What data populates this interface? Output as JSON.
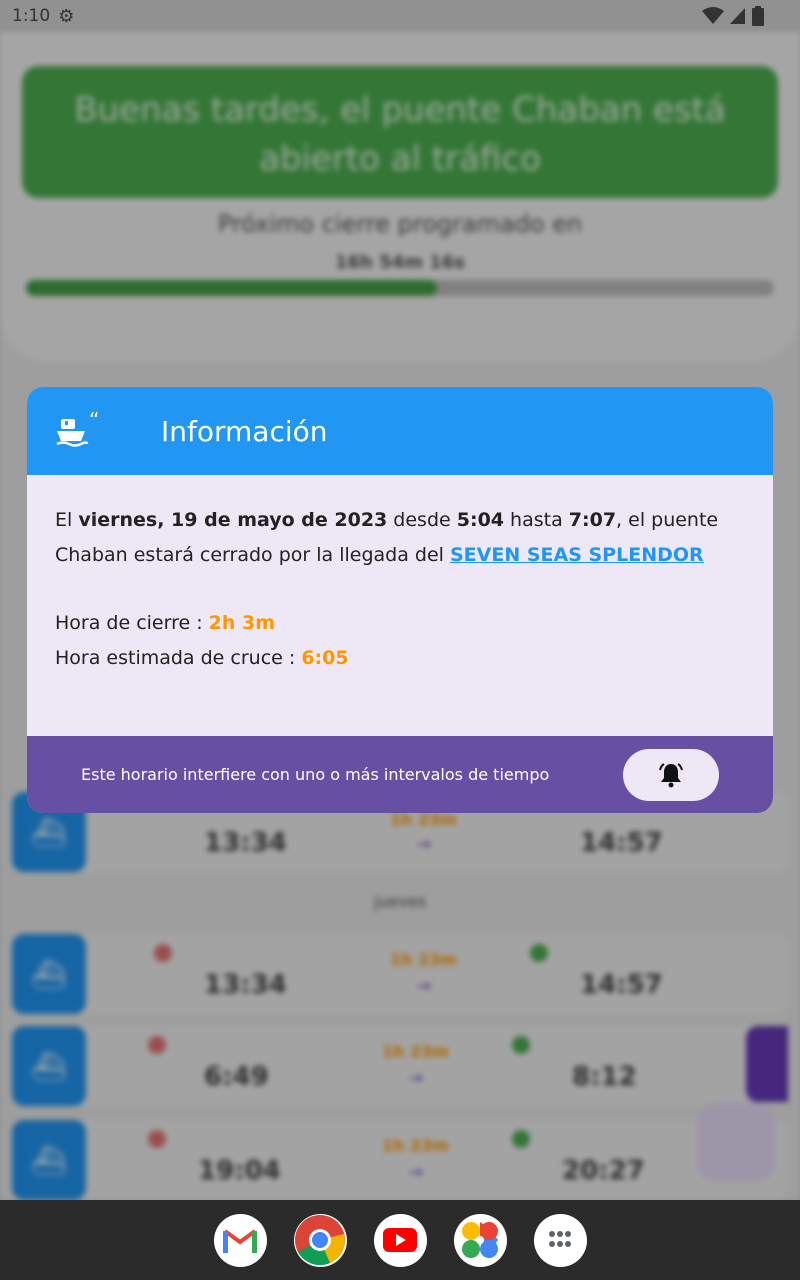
{
  "status_bar": {
    "time": "1:10"
  },
  "background": {
    "banner_text": "Buenas tardes, el puente Chaban está abierto al tráfico",
    "next_close_label": "Próximo cierre programado en",
    "countdown": "16h 54m 16s",
    "progress_fraction": 0.55,
    "day_label": "jueves",
    "rows": [
      {
        "close": "13:34",
        "open": "14:57",
        "dur": "1h 23m"
      },
      {
        "close": "13:34",
        "open": "14:57",
        "dur": "1h 23m"
      },
      {
        "close": "6:49",
        "open": "8:12",
        "dur": "1h 23m"
      },
      {
        "close": "19:04",
        "open": "20:27",
        "dur": "1h 23m"
      }
    ]
  },
  "dialog": {
    "title": "Información",
    "body": {
      "p1_prefix": "El ",
      "date": "viernes, 19 de mayo de 2023",
      "from_word": " desde ",
      "start": "5:04",
      "to_word": " hasta ",
      "end": "7:07",
      "p1_suffix": ", el puente Chaban estará cerrado por la llegada del ",
      "ship": "SEVEN SEAS SPLENDOR",
      "closing_label": "Hora de cierre : ",
      "closing_value": "2h 3m",
      "crossing_label": "Hora estimada de cruce : ",
      "crossing_value": "6:05"
    },
    "footer_text": "Este horario interfiere con uno o más intervalos de tiempo"
  },
  "colors": {
    "primary": "#2196f3",
    "footer": "#6750a4",
    "accent_orange": "#ff9800",
    "dialog_bg": "#ede7f6"
  },
  "nav_apps": [
    "gmail-icon",
    "chrome-icon",
    "youtube-icon",
    "photos-icon",
    "app-drawer-icon"
  ]
}
